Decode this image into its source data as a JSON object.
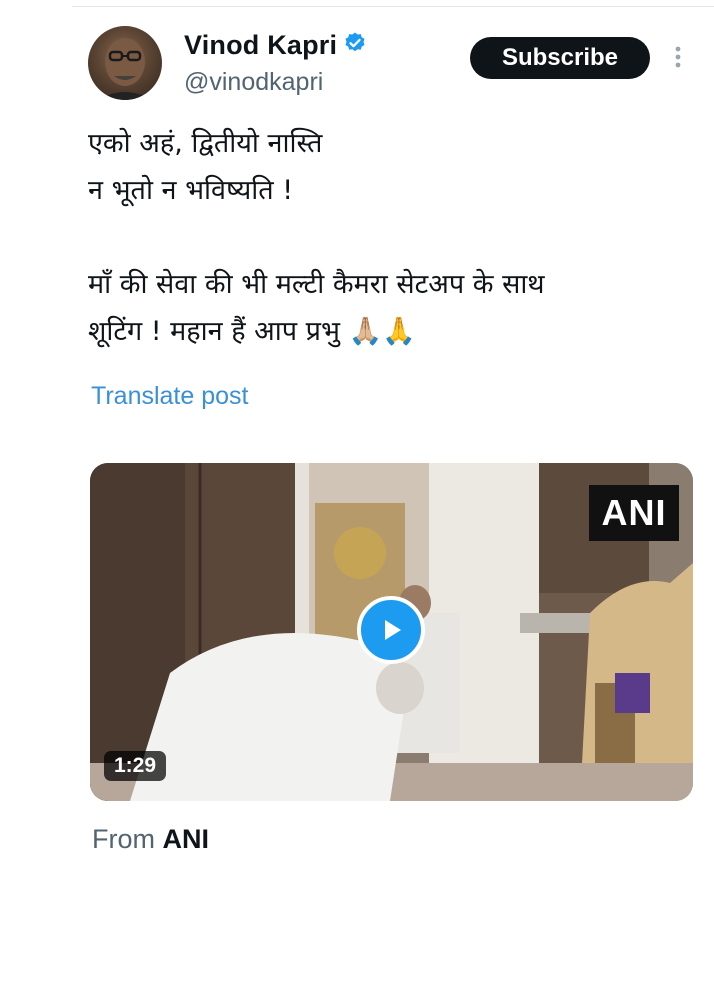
{
  "author": {
    "display_name": "Vinod Kapri",
    "handle": "@vinodkapri",
    "verified": true
  },
  "header": {
    "subscribe_label": "Subscribe"
  },
  "post": {
    "text": "एको अहं, द्वितीयो नास्ति\nन भूतो न भविष्यति !\n\nमाँ की सेवा की भी मल्टी कैमरा सेटअप के साथ\nशूटिंग ! महान हैं आप प्रभु 🙏🏼🙏",
    "translate_label": "Translate post"
  },
  "media": {
    "badge": "ANI",
    "duration": "1:29"
  },
  "source": {
    "prefix": "From",
    "name": "ANI"
  },
  "colors": {
    "accent": "#1d9bf0",
    "link": "#3a90d6",
    "text": "#0f1419",
    "muted": "#536471"
  }
}
